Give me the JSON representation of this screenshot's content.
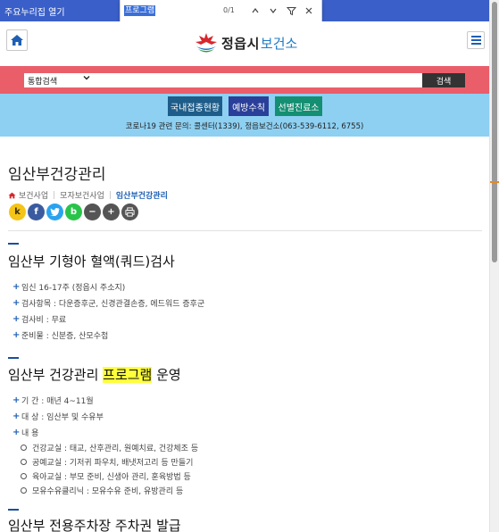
{
  "skipbar": {
    "text": "주요누리집 열기"
  },
  "findbar": {
    "query": "프로그램",
    "count": "0/1"
  },
  "header": {
    "logo_name": "정읍시",
    "logo_sub": "보건소"
  },
  "search": {
    "select_value": "통합검색",
    "button_label": "검색"
  },
  "covid": {
    "buttons": [
      "국내접종현황",
      "예방수칙",
      "선별진료소"
    ],
    "info": "코로나19 관련 문의: 콜센터(1339), 정읍보건소(063-539-6112, 6755)"
  },
  "page": {
    "title": "임산부건강관리",
    "breadcrumb": [
      "보건사업",
      "모자보건사업",
      "임산부건강관리"
    ],
    "share": [
      "k",
      "f",
      "t",
      "b",
      "−",
      "+",
      "print"
    ]
  },
  "sections": [
    {
      "title": "임산부 기형아 혈액(쿼드)검사",
      "items": [
        "임신 16-17주 (정읍시 주소지)",
        "검사항목 : 다운증후군, 신경관결손증, 에드워드 증후군",
        "검사비 : 무료",
        "준비물 : 신분증, 산모수첩"
      ]
    },
    {
      "title_pre": "임산부 건강관리 ",
      "title_hl": "프로그램",
      "title_post": " 운영",
      "items": [
        "기 간 : 매년 4~11월",
        "대 상 : 임산부 및 수유부",
        "내 용"
      ],
      "subitems": [
        "건강교실 : 태교, 산후관리, 원예치료, 건강체조 등",
        "공예교실 : 기저귀 파우치, 배냇저고리 등 만들기",
        "육아교실 : 부모 준비, 신생아 관리, 훈육방법 등",
        "모유수유클리닉 : 모유수유 준비, 유방관리 등"
      ]
    },
    {
      "title": "임산부 전용주차장 주차권 발급"
    }
  ],
  "colors": {
    "skipbar": "#3a5fc8",
    "search_band": "#ea5e6a",
    "covid_band": "#8ed0f2",
    "highlight": "#ffff3b",
    "accent": "#1e5fb4"
  },
  "icons": [
    "home-icon",
    "hamburger-menu-icon",
    "logo-icon",
    "chevron-up-icon",
    "chevron-down-icon",
    "filter-icon",
    "close-icon",
    "print-icon"
  ]
}
